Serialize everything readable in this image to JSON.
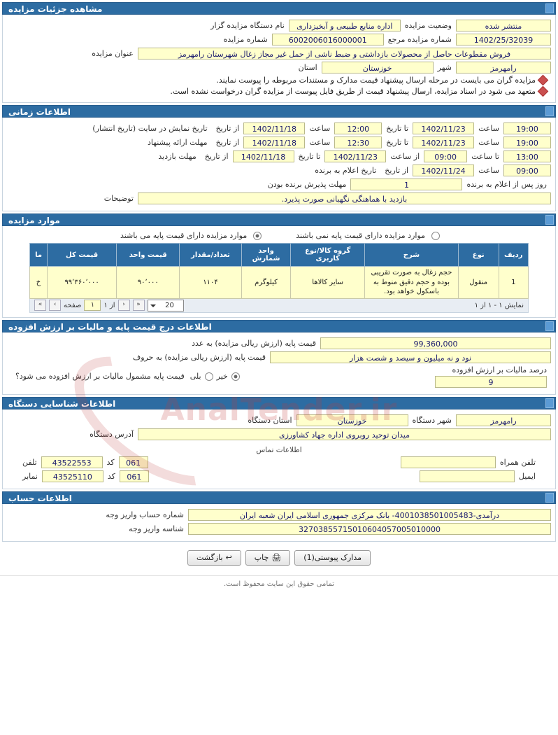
{
  "sections": {
    "details": {
      "title": "مشاهده جزئیات مزایده",
      "fields": {
        "org_label": "نام دستگاه مزایده گزار",
        "org_value": "اداره منابع طبیعی و آبخیزداری",
        "status_label": "وضعیت مزایده",
        "status_value": "منتشر شده",
        "number_label": "شماره مزایده",
        "number_value": "6002006016000001",
        "ref_label": "شماره مزایده مرجع",
        "ref_value": "1402/25/32039",
        "subject_label": "عنوان مزایده",
        "subject_value": "فروش مقطوعات حاصل از محصولات بازداشتی و ضبط ناشی از حمل غیر مجاز زغال شهرستان رامهرمز",
        "province_label": "استان",
        "province_value": "خوزستان",
        "city_label": "شهر",
        "city_value": "رامهرمز"
      },
      "notes": [
        "مزایده گران می بایست در مرحله ارسال پیشنهاد قیمت مدارک و مستندات مربوطه را پیوست نمایند.",
        "متعهد می شود در اسناد مزایده، ارسال پیشنهاد قیمت از طریق فایل پیوست از مزایده گران درخواست نشده است."
      ]
    },
    "time": {
      "title": "اطلاعات زمانی",
      "rows": [
        {
          "label": "تاریخ نمایش در سایت (تاریخ انتشار)",
          "from_label": "از تاریخ",
          "from_value": "1402/11/18",
          "hour_label": "ساعت",
          "hour_value": "12:00",
          "to_label": "تا تاریخ",
          "to_value": "1402/11/23",
          "hour2_label": "ساعت",
          "hour2_value": "19:00"
        },
        {
          "label": "مهلت ارائه پیشنهاد",
          "from_label": "از تاریخ",
          "from_value": "1402/11/18",
          "hour_label": "ساعت",
          "hour_value": "12:30",
          "to_label": "تا تاریخ",
          "to_value": "1402/11/23",
          "hour2_label": "ساعت",
          "hour2_value": "19:00"
        },
        {
          "label": "مهلت بازدید",
          "from_label": "از تاریخ",
          "from_value": "1402/11/18",
          "to_label": "تا تاریخ",
          "to_value": "1402/11/23",
          "from_hour_label": "از ساعت",
          "from_hour_value": "09:00",
          "to_hour_label": "تا ساعت",
          "to_hour_value": "13:00"
        },
        {
          "label": "تاریخ اعلام به برنده",
          "from_label": "از تاریخ",
          "from_value": "1402/11/24",
          "hour_label": "ساعت",
          "hour_value": "09:00"
        }
      ],
      "accept_label": "مهلت پذیرش برنده بودن",
      "accept_value": "1",
      "accept_suffix": "روز پس از اعلام به برنده",
      "desc_label": "توضیحات",
      "desc_value": "بازدید با هماهنگی نگهبانی صورت پذیرد."
    },
    "items": {
      "title": "موارد مزایده",
      "radio_with_price": "موارد مزایده دارای قیمت پایه می باشند",
      "radio_without_price": "موارد مزایده دارای قیمت پایه نمی باشند",
      "columns": [
        "ردیف",
        "نوع",
        "شرح",
        "گروه کالا/نوع کاربری",
        "واحد شمارش",
        "تعداد/مقدار",
        "قیمت واحد",
        "قیمت کل",
        "ما"
      ],
      "rows": [
        {
          "radif": "1",
          "noe": "منقول",
          "sharh": "حجم زغال به صورت تقریبی بوده و حجم دقیق منوط به باسکول خواهد بود.",
          "group": "سایر کالاها",
          "unit": "کیلوگرم",
          "qty": "۱۱۰۴",
          "unit_price": "۹۰٬۰۰۰",
          "total_price": "۹۹٬۳۶۰٬۰۰۰",
          "extra": "خ"
        }
      ],
      "pager": {
        "display_text": "نمایش ۱ - ۱ از ۱",
        "page_label": "صفحه",
        "page_value": "۱",
        "of_label": "از ۱",
        "page_size": "20"
      }
    },
    "price": {
      "title": "اطلاعات درج قیمت پایه و مالیات بر ارزش افزوده",
      "base_label": "قیمت پایه (ارزش ریالی مزایده) به عدد",
      "base_value": "99,360,000",
      "words_label": "قیمت پایه (ارزش ریالی مزایده) به حروف",
      "words_value": "نود و نه میلیون و سیصد و شصت هزار",
      "vat_question": "قیمت پایه مشمول مالیات بر ارزش افزوده می شود؟",
      "vat_yes": "بلی",
      "vat_no": "خیر",
      "vat_percent_label": "درصد مالیات بر ارزش افزوده",
      "vat_percent_value": "9"
    },
    "org": {
      "title": "اطلاعات شناسایی دستگاه",
      "province_label": "استان دستگاه",
      "province_value": "خوزستان",
      "city_label": "شهر دستگاه",
      "city_value": "رامهرمز",
      "address_label": "آدرس دستگاه",
      "address_value": "میدان توحید روبروی اداره جهاد کشاورزی",
      "contact_title": "اطلاعات تماس",
      "phone_label": "تلفن",
      "phone_value": "43522553",
      "phone_code_label": "کد",
      "phone_code_value": "061",
      "mobile_label": "تلفن همراه",
      "mobile_value": "",
      "fax_label": "نمابر",
      "fax_value": "43525110",
      "fax_code_label": "کد",
      "fax_code_value": "061",
      "email_label": "ایمیل",
      "email_value": ""
    },
    "account": {
      "title": "اطلاعات حساب",
      "account_label": "شماره حساب واریز وجه",
      "account_value": "درآمدی-4001038501005483- بانک مرکزی جمهوری اسلامی ایران شعبه ایران",
      "shenase_label": "شناسه واریز وجه",
      "shenase_value": "32703855715010604057005010000"
    }
  },
  "buttons": {
    "attachments": "مدارک پیوستی(1)",
    "print": "چاپ",
    "back": "بازگشت"
  },
  "footer": "تمامی حقوق این سایت محفوظ است.",
  "watermark": "AnalTender.ir",
  "colors": {
    "header_blue": "#2d6ca2",
    "field_yellow": "#ffffcc",
    "field_text": "#1a1a6e"
  }
}
